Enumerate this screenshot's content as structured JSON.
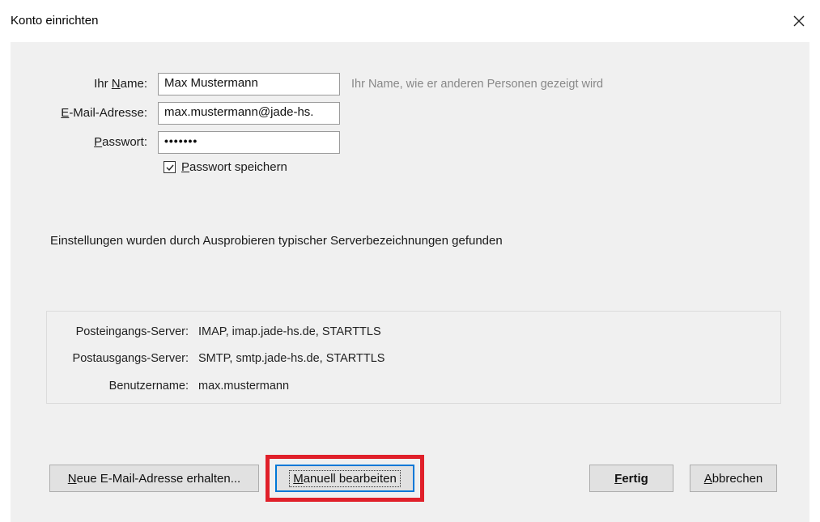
{
  "window": {
    "title": "Konto einrichten"
  },
  "form": {
    "name": {
      "label_pre": "Ihr ",
      "label_u": "N",
      "label_post": "ame:",
      "value": "Max Mustermann",
      "hint": "Ihr Name, wie er anderen Personen gezeigt wird"
    },
    "email": {
      "label_u": "E",
      "label_post": "-Mail-Adresse:",
      "value": "max.mustermann@jade-hs."
    },
    "password": {
      "label_u": "P",
      "label_post": "asswort:",
      "value": "•••••••"
    },
    "save_password": {
      "checked": true,
      "label_u": "P",
      "label_post": "asswort speichern"
    }
  },
  "status": "Einstellungen wurden durch Ausprobieren typischer Serverbezeichnungen gefunden",
  "servers": {
    "incoming_label": "Posteingangs-Server:",
    "incoming_value": "IMAP, imap.jade-hs.de, STARTTLS",
    "outgoing_label": "Postausgangs-Server:",
    "outgoing_value": "SMTP, smtp.jade-hs.de, STARTTLS",
    "username_label": "Benutzername:",
    "username_value": "max.mustermann"
  },
  "buttons": {
    "new_email": {
      "label_pre": "",
      "label_u": "N",
      "label_post": "eue E-Mail-Adresse erhalten..."
    },
    "manual": {
      "label_pre": "",
      "label_u": "M",
      "label_post": "anuell bearbeiten"
    },
    "done": {
      "label_pre": "",
      "label_u": "F",
      "label_post": "ertig"
    },
    "cancel": {
      "label_pre": "",
      "label_u": "A",
      "label_post": "bbrechen"
    }
  },
  "colors": {
    "highlight": "#e0202a",
    "focus": "#0078d7"
  }
}
